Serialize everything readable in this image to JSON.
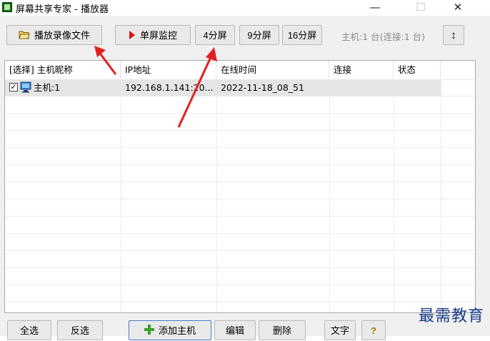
{
  "window": {
    "title": "屏幕共享专家 - 播放器",
    "minimize_glyph": "—",
    "maximize_glyph": "☐",
    "close_glyph": "✕"
  },
  "toolbar": {
    "play_recording_label": "播放录像文件",
    "single_screen_label": "单屏监控",
    "four_screen_label": "4分屏",
    "nine_screen_label": "9分屏",
    "sixteen_screen_label": "16分屏",
    "host_status": "主机:1 台(连接:1 台)",
    "sort_glyph": "↕"
  },
  "list": {
    "columns": [
      "[选择] 主机昵称",
      "IP地址",
      "在线时间",
      "连接",
      "状态"
    ],
    "rows": [
      {
        "checked": true,
        "check_glyph": "✓",
        "nickname": "主机:1",
        "ip": "192.168.1.141:20...",
        "online_time": "2022-11-18_08_51",
        "connection": "",
        "status": ""
      }
    ]
  },
  "bottom_bar": {
    "select_all_label": "全选",
    "invert_label": "反选",
    "add_host_label": "添加主机",
    "edit_label": "编辑",
    "delete_label": "删除",
    "text_label": "文字",
    "help_glyph": "?"
  },
  "watermark": "最需教育",
  "colors": {
    "annotation_arrow": "#e02020",
    "play_icon": "#e01010",
    "add_icon": "#3aa02a",
    "help_icon": "#e8c400",
    "watermark": "#1a3a8a"
  }
}
